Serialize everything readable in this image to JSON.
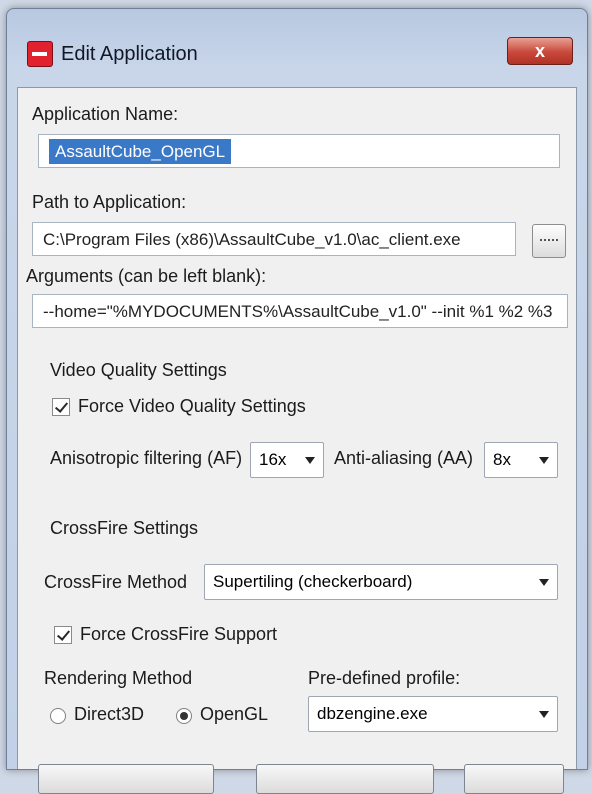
{
  "window": {
    "title": "Edit Application",
    "close_glyph": "x"
  },
  "app_name": {
    "label": "Application Name:",
    "value": "AssaultCube_OpenGL"
  },
  "path": {
    "label": "Path to Application:",
    "value": "C:\\Program Files (x86)\\AssaultCube_v1.0\\ac_client.exe"
  },
  "arguments": {
    "label": "Arguments (can be left blank):",
    "value": "--home=\"%MYDOCUMENTS%\\AssaultCube_v1.0\" --init %1 %2 %3"
  },
  "video": {
    "section_label": "Video Quality Settings",
    "force_label": "Force Video Quality Settings",
    "force_checked": true,
    "af_label": "Anisotropic filtering (AF)",
    "af_value": "16x",
    "aa_label": "Anti-aliasing (AA)",
    "aa_value": "8x"
  },
  "crossfire": {
    "section_label": "CrossFire Settings",
    "method_label": "CrossFire Method",
    "method_value": "Supertiling (checkerboard)",
    "force_label": "Force CrossFire Support",
    "force_checked": true
  },
  "rendering": {
    "label": "Rendering Method",
    "option_direct3d": "Direct3D",
    "option_opengl": "OpenGL",
    "selected": "OpenGL"
  },
  "profile": {
    "label": "Pre-defined profile:",
    "value": "dbzengine.exe"
  },
  "icons": {
    "app": "app-icon",
    "close": "close-icon",
    "browse": "ellipsis-icon",
    "dropdown": "chevron-down-icon"
  },
  "colors": {
    "selection": "#3a78c8",
    "close_button": "#c8483b",
    "app_icon": "#e1222e"
  }
}
